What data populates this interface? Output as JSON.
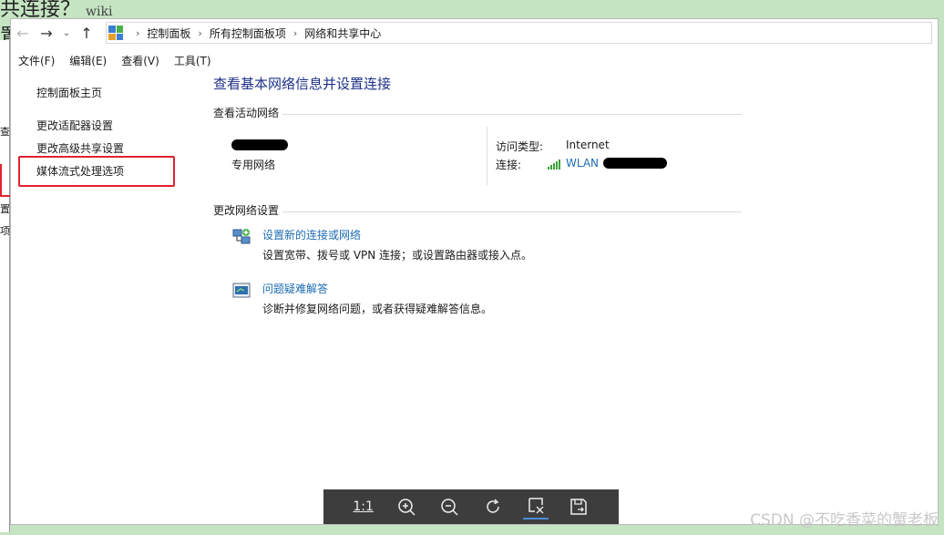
{
  "background": {
    "top_text": "共连接？",
    "top_text_trail": "wiki",
    "left_text": "置",
    "strip_fragments": [
      "查",
      "置",
      "项"
    ]
  },
  "nav": {
    "back_icon": "back-arrow-icon",
    "forward_icon": "forward-arrow-icon",
    "recent_icon": "chevron-down-icon",
    "up_icon": "up-arrow-icon"
  },
  "breadcrumb": [
    "控制面板",
    "所有控制面板项",
    "网络和共享中心"
  ],
  "menu": [
    "文件(F)",
    "编辑(E)",
    "查看(V)",
    "工具(T)"
  ],
  "sidebar": {
    "items": [
      "控制面板主页",
      "更改适配器设置",
      "更改高级共享设置",
      "媒体流式处理选项"
    ],
    "highlight_color": "#e0232f"
  },
  "main": {
    "title": "查看基本网络信息并设置连接",
    "active_networks_label": "查看活动网络",
    "network_type": "专用网络",
    "access_type_label": "访问类型:",
    "access_type_value": "Internet",
    "connection_label": "连接:",
    "connection_value": "WLAN",
    "change_settings_label": "更改网络设置",
    "tasks": [
      {
        "title": "设置新的连接或网络",
        "desc": "设置宽带、拨号或 VPN 连接；或设置路由器或接入点。",
        "icon": "new-connection-icon"
      },
      {
        "title": "问题疑难解答",
        "desc": "诊断并修复网络问题，或者获得疑难解答信息。",
        "icon": "troubleshoot-icon"
      }
    ]
  },
  "viewer_toolbar": {
    "buttons": [
      "1:1",
      "zoom-in-icon",
      "zoom-out-icon",
      "rotate-icon",
      "crop-icon",
      "save-icon"
    ]
  },
  "watermark": "CSDN @不吃香菜的蟹老板",
  "colors": {
    "link": "#1e6cb5",
    "title": "#1e3287",
    "highlight": "#e0232f",
    "background": "#c5e4c2"
  }
}
